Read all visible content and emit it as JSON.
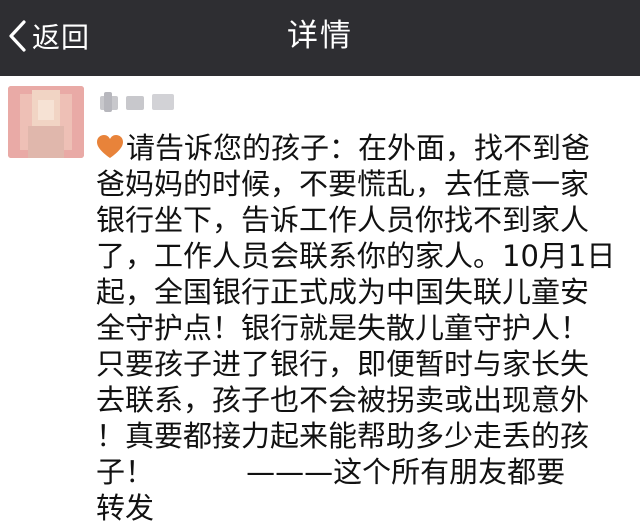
{
  "navbar": {
    "back_label": "返回",
    "title": "详情",
    "background": "#2e2e32"
  },
  "post": {
    "author_avatar": "blurred-avatar",
    "author_name": "",
    "icon": "heart-icon",
    "heart_color": "#e8833a",
    "lines": [
      "请告诉您的孩子：在外面，找不到爸",
      "爸妈妈的时候，不要慌乱，去任意一家",
      "银行坐下，告诉工作人员你找不到家人",
      "了，工作人员会联系你的家人。10月1日",
      "起，全国银行正式成为中国失联儿童安",
      "全守护点！银行就是失散儿童守护人！",
      "只要孩子进了银行，即便暂时与家长失",
      "去联系，孩子也不会被拐卖或出现意外",
      "！真要都接力起来能帮助多少走丢的孩",
      "子！          ———这个所有朋友都要",
      "转发"
    ]
  }
}
